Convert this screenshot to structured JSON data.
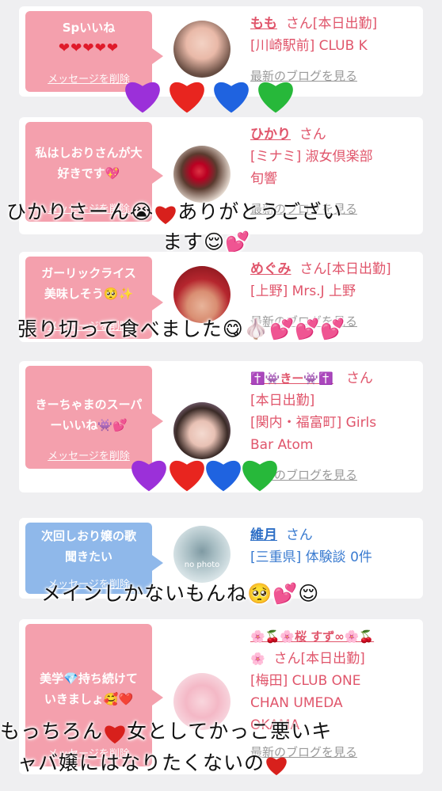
{
  "cards": [
    {
      "bubble_text": "Spいいね",
      "bubble_hearts": "❤❤❤❤❤",
      "delete_label": "メッセージを削除",
      "name": "もも",
      "suffix": "さん[本日出勤]",
      "line2": "[川崎駅前] CLUB K",
      "line3": "",
      "blog": "最新のブログを見る"
    },
    {
      "bubble_text": "私はしおりさんが大好きです💖",
      "delete_label": "メッセージを削除",
      "name": "ひかり",
      "suffix": "さん",
      "line2": "[ミナミ] 淑女倶楽部",
      "line3": "旬響",
      "blog": "最新のブログを見る"
    },
    {
      "bubble_text": "ガーリックライス美味しそう🥺✨",
      "delete_label": "メッセージを削除",
      "name": "めぐみ",
      "suffix": "さん[本日出勤]",
      "line2": "[上野] Mrs.J 上野",
      "blog": "最新のブログを見る"
    },
    {
      "bubble_text": "きーちゃまのスーパーいいね👾💕",
      "delete_label": "メッセージを削除",
      "name": "✝️👾きー👾✝️",
      "suffix": "さん",
      "line2": "[本日出勤]",
      "line3": "[関内・福富町] Girls",
      "line4": "Bar Atom",
      "blog": "最新のブログを見る"
    },
    {
      "bubble_text": "次回しおり嬢の歌聞きたい",
      "delete_label": "メッセージを削除",
      "name": "維月",
      "suffix": "さん",
      "line2": "[三重県] 体験談 0件",
      "avatar_text": "no photo"
    },
    {
      "bubble_text": "美学💎持ち続けていきましょ🥰❤️",
      "delete_label": "メッセージを削除",
      "name": "🌸🍒🌸桜 すず∞🌸🍒",
      "name2": "🌸",
      "suffix": "さん[本日出勤]",
      "line2": "[梅田] CLUB ONE",
      "line3": "CHAN UMEDA",
      "line4": "OKAMA",
      "blog": "最新のブログを見る"
    }
  ],
  "overlays": {
    "t1": "ひかりさーん😭",
    "t1b": "ありがとうござい",
    "t2": "ます😌💕",
    "t3": "張り切って食べました😋🧄💕💕💕",
    "t4": "メインしかないもんね🥺💕😌",
    "t5a": "もっちろん",
    "t5b": "女としてかっこ悪いキ",
    "t6": "ャバ嬢にはなりたくないの"
  },
  "colors": {
    "bubble_pink": "#f4a0ad",
    "bubble_blue": "#8fb8ea",
    "name_pink": "#e0556b",
    "name_blue": "#2e6fc6"
  }
}
